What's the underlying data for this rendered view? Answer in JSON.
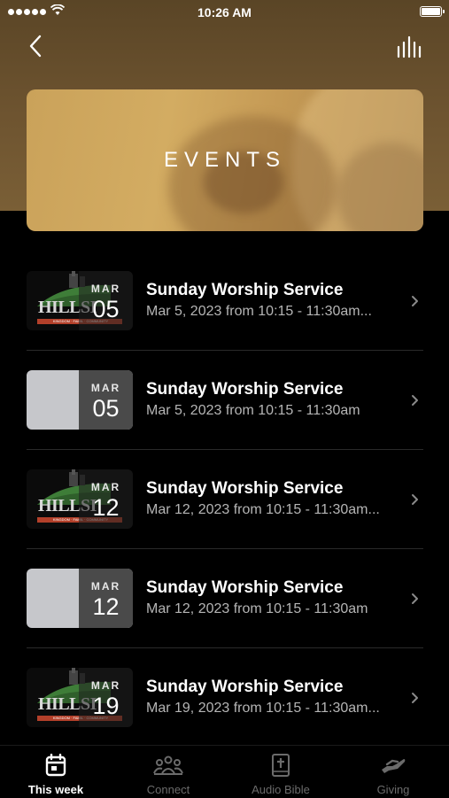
{
  "status_bar": {
    "time": "10:26 AM"
  },
  "hero": {
    "title": "EVENTS"
  },
  "events": [
    {
      "month": "MAR",
      "day": "05",
      "title": "Sunday Worship Service",
      "subtitle": "Mar 5, 2023 from 10:15 - 11:30am...",
      "thumbnail": "logo",
      "logo_text": "HILLSI",
      "logo_tagline": "KINGDOM · FAMIL · COMMUNITY"
    },
    {
      "month": "MAR",
      "day": "05",
      "title": "Sunday Worship Service",
      "subtitle": "Mar 5, 2023 from 10:15 - 11:30am",
      "thumbnail": "plain"
    },
    {
      "month": "MAR",
      "day": "12",
      "title": "Sunday Worship Service",
      "subtitle": "Mar 12, 2023 from 10:15 - 11:30am...",
      "thumbnail": "logo",
      "logo_text": "HILLSI",
      "logo_tagline": "KINGDOM · FAMIL · COMMUNITY"
    },
    {
      "month": "MAR",
      "day": "12",
      "title": "Sunday Worship Service",
      "subtitle": "Mar 12, 2023 from 10:15 - 11:30am",
      "thumbnail": "plain"
    },
    {
      "month": "MAR",
      "day": "19",
      "title": "Sunday Worship Service",
      "subtitle": "Mar 19, 2023 from 10:15 - 11:30am...",
      "thumbnail": "logo",
      "logo_text": "HILLSI",
      "logo_tagline": "KINGDOM · FAMIL · COMMUNITY"
    }
  ],
  "tabbar": {
    "tabs": [
      {
        "label": "This week",
        "icon": "calendar-icon",
        "active": true
      },
      {
        "label": "Connect",
        "icon": "group-icon",
        "active": false
      },
      {
        "label": "Audio Bible",
        "icon": "bible-icon",
        "active": false
      },
      {
        "label": "Giving",
        "icon": "giving-hand-icon",
        "active": false
      }
    ]
  },
  "colors": {
    "header": "#6e5430",
    "hero": "#caa25a",
    "background": "#000000",
    "subtitle": "#b5b5b5",
    "inactive_tab": "#6b6b6b"
  }
}
